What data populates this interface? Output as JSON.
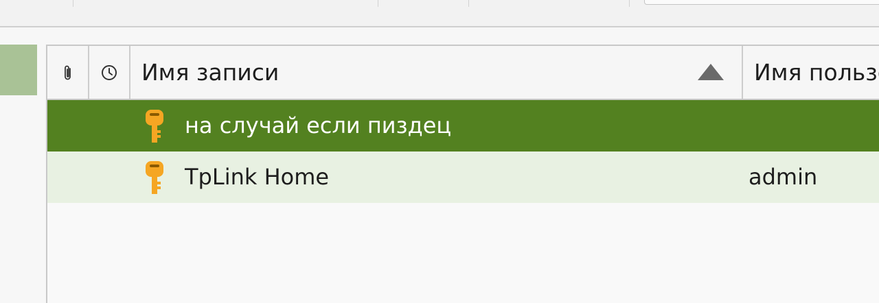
{
  "table": {
    "columns": {
      "attachment_icon": "paperclip-icon",
      "modified_icon": "clock-icon",
      "title": "Имя записи",
      "username": "Имя пользо"
    },
    "sort": "ascending",
    "rows": [
      {
        "icon": "key-icon",
        "title": "на случай если пиздец",
        "username": "",
        "selected": true
      },
      {
        "icon": "key-icon",
        "title": "TpLink Home",
        "username": "admin",
        "selected": false
      }
    ]
  },
  "colors": {
    "selected_row": "#538120",
    "alternate_row": "#e8f1e2",
    "sidebar_selected": "#a9c296",
    "key_icon": "#f5a623"
  }
}
